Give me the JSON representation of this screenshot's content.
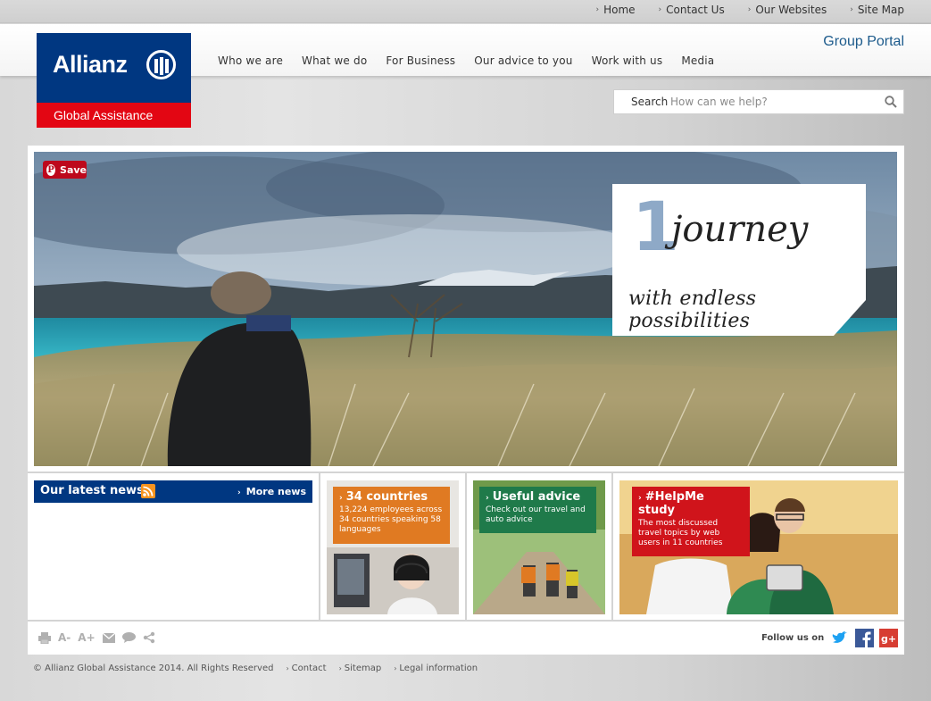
{
  "util_links": [
    "Home",
    "Contact Us",
    "Our Websites",
    "Site Map"
  ],
  "logo": {
    "word": "Allianz",
    "sub": "Global Assistance"
  },
  "nav": [
    "Who we are",
    "What we do",
    "For Business",
    "Our advice to you",
    "Work with us",
    "Media"
  ],
  "group_portal": "Group Portal",
  "search": {
    "label": "Search",
    "placeholder": "How can we help?"
  },
  "hero": {
    "pin_label": "Save",
    "card_number": "1",
    "card_title": "journey",
    "card_sub": "with endless possibilities"
  },
  "news": {
    "title": "Our latest news",
    "more": "More news"
  },
  "tiles": [
    {
      "title": "34 countries",
      "desc": "13,224 employees across 34 countries speaking 58 languages"
    },
    {
      "title": "Useful advice",
      "desc": "Check out our travel and auto advice"
    },
    {
      "title": "#HelpMe study",
      "desc": "The most discussed travel topics by web users in 11 countries"
    }
  ],
  "tools": {
    "font_smaller": "A-",
    "font_larger": "A+"
  },
  "follow": "Follow us on",
  "footer": {
    "copyright": "© Allianz Global Assistance 2014. All Rights Reserved",
    "links": [
      "Contact",
      "Sitemap",
      "Legal information"
    ]
  },
  "colors": {
    "brand_blue": "#003781",
    "brand_red": "#e30613",
    "orange": "#e07a22",
    "green": "#1f7a4a"
  }
}
